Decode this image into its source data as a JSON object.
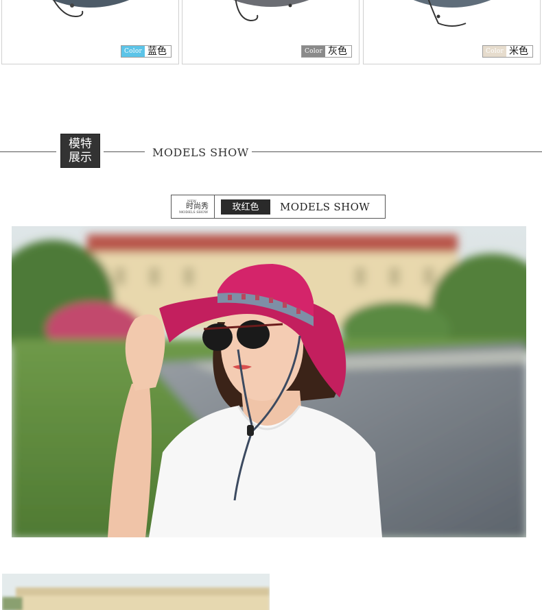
{
  "swatches": [
    {
      "chip_label": "Color",
      "color_name": "蓝色",
      "chip_color": "#5cc4e8",
      "hat_color": "#5a6a7a"
    },
    {
      "chip_label": "Color",
      "color_name": "灰色",
      "chip_color": "#8a8a8a",
      "hat_color": "#6e7076"
    },
    {
      "chip_label": "Color",
      "color_name": "米色",
      "chip_color": "#e6dccd",
      "hat_color": "#5f6d7a"
    }
  ],
  "section": {
    "badge_line1": "模特",
    "badge_line2": "展示",
    "title": "MODELS SHOW"
  },
  "color_label": {
    "tag_new": "NEW",
    "tag_cn": "时尚秀",
    "tag_en": "MODELS SHOW",
    "color_name": "玫红色",
    "title": "MODELS SHOW"
  },
  "photo": {
    "hat_color": "#d4246a",
    "shirt_color": "#f7f7f7"
  }
}
